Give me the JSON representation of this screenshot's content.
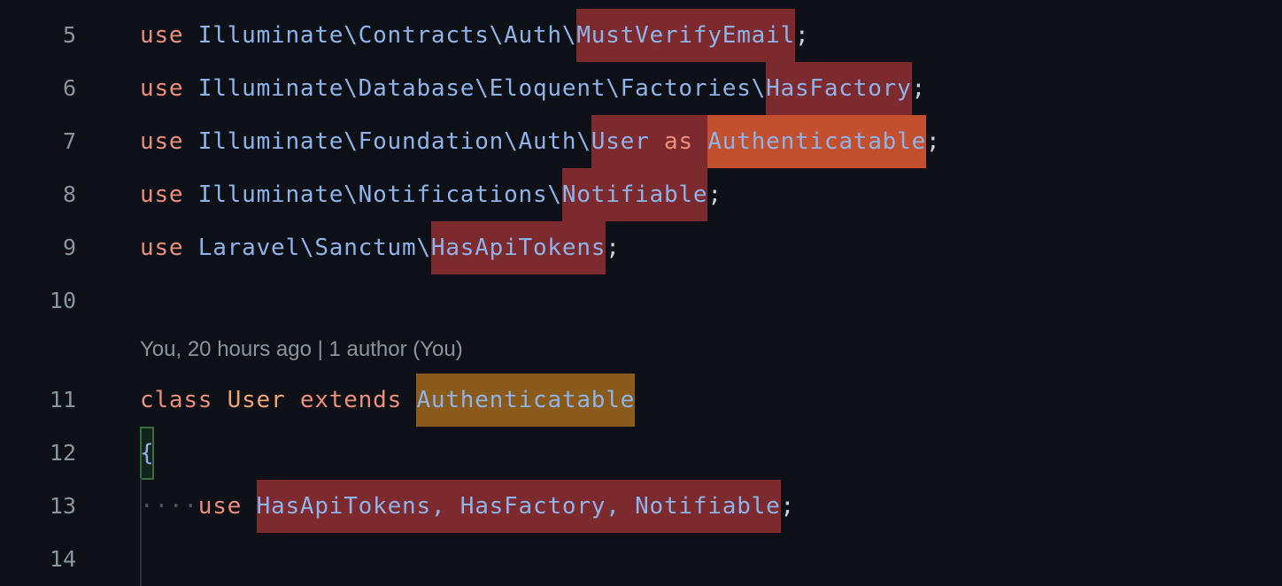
{
  "lines": [
    {
      "number": "5",
      "tokens": {
        "kw": "use",
        "path": "Illuminate\\Contracts\\Auth\\",
        "name": "MustVerifyEmail",
        "end": ";"
      }
    },
    {
      "number": "6",
      "tokens": {
        "kw": "use",
        "path": "Illuminate\\Database\\Eloquent\\Factories\\",
        "name": "HasFactory",
        "end": ";"
      }
    },
    {
      "number": "7",
      "tokens": {
        "kw": "use",
        "path": "Illuminate\\Foundation\\Auth\\",
        "name": "User",
        "as": "as",
        "alias": "Authenticatable",
        "end": ";"
      }
    },
    {
      "number": "8",
      "tokens": {
        "kw": "use",
        "path": "Illuminate\\Notifications\\",
        "name": "Notifiable",
        "end": ";"
      }
    },
    {
      "number": "9",
      "tokens": {
        "kw": "use",
        "path": "Laravel\\Sanctum\\",
        "name": "HasApiTokens",
        "end": ";"
      }
    },
    {
      "number": "10"
    },
    {
      "number": "11",
      "tokens": {
        "kw": "class",
        "name": "User",
        "extends": "extends",
        "parent": "Authenticatable"
      }
    },
    {
      "number": "12",
      "tokens": {
        "brace": "{"
      }
    },
    {
      "number": "13",
      "tokens": {
        "ws": "····",
        "kw": "use",
        "traits": "HasApiTokens, HasFactory, Notifiable",
        "end": ";"
      }
    },
    {
      "number": "14"
    }
  ],
  "blame": "You, 20 hours ago | 1 author (You)",
  "colors": {
    "background": "#0d1117",
    "keyword": "#ec8e7c",
    "identifier": "#8fb3e8",
    "highlight_red": "#7c2a2d",
    "highlight_orange": "#c2502e",
    "highlight_amber": "#8a5a1a"
  }
}
